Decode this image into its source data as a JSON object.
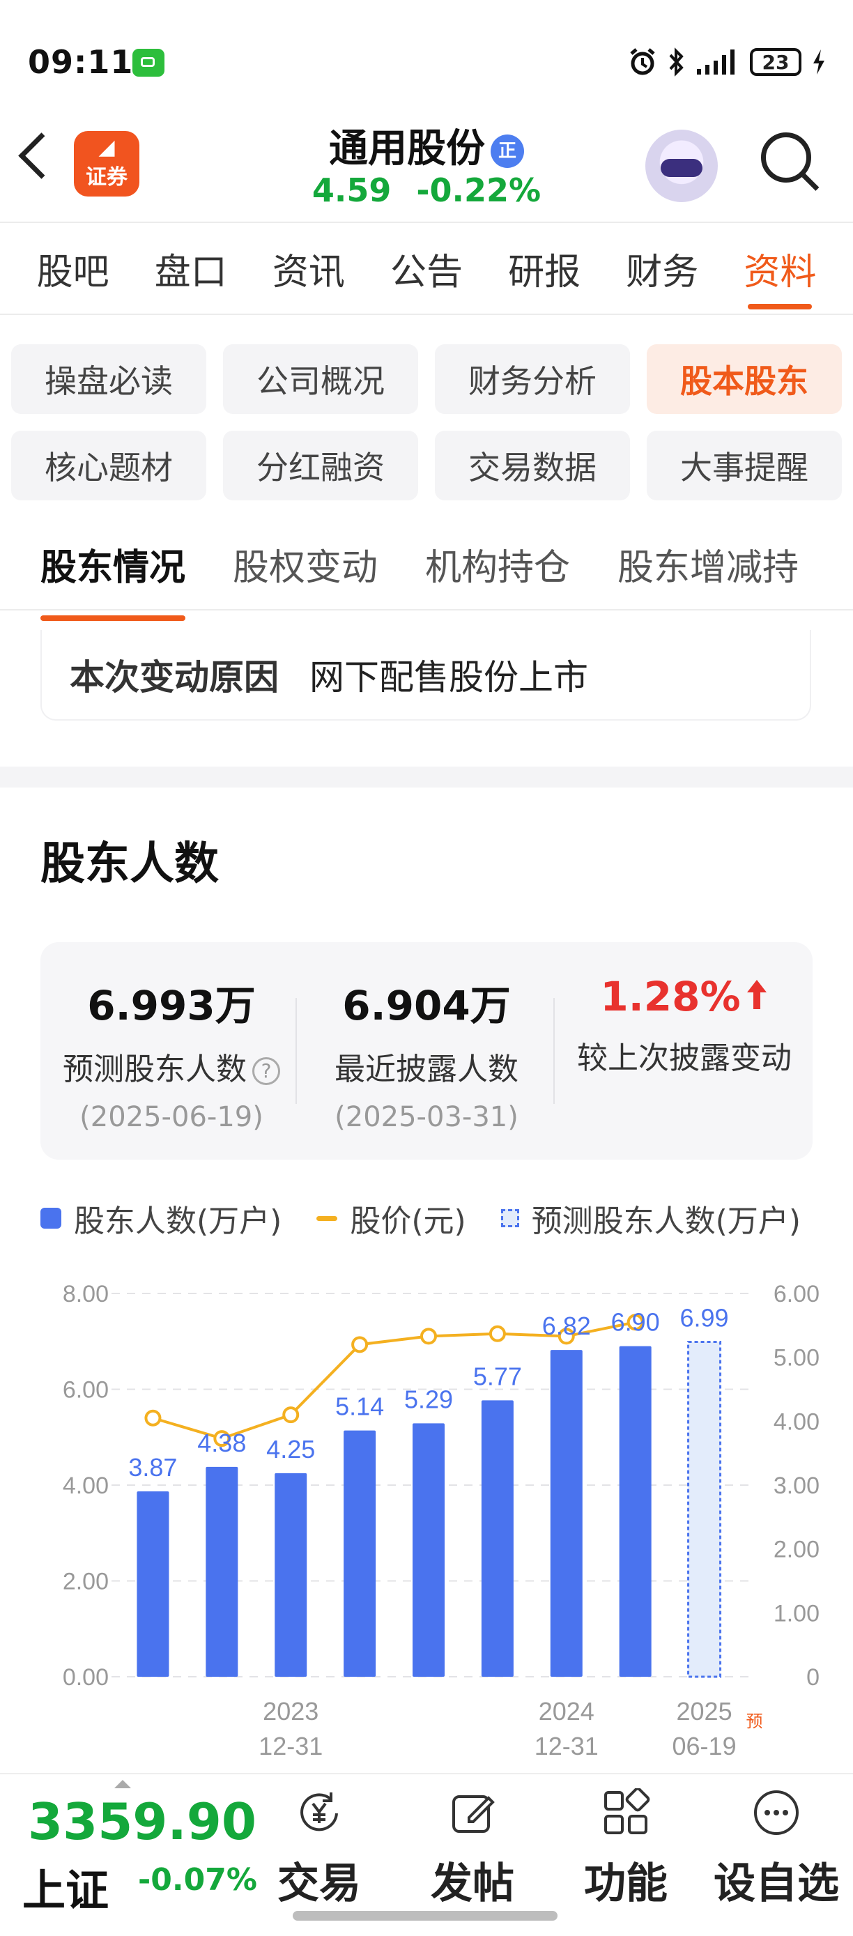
{
  "status_bar": {
    "time": "09:11",
    "battery": "23"
  },
  "header": {
    "app_logo_text": "证券",
    "stock_name": "通用股份",
    "badge": "正",
    "price": "4.59",
    "change_pct": "-0.22%"
  },
  "main_tabs": [
    "股吧",
    "盘口",
    "资讯",
    "公告",
    "研报",
    "财务",
    "资料"
  ],
  "chips": [
    "操盘必读",
    "公司概况",
    "财务分析",
    "股本股东",
    "核心题材",
    "分红融资",
    "交易数据",
    "大事提醒"
  ],
  "sub_tabs": [
    "股东情况",
    "股权变动",
    "机构持仓",
    "股东增减持"
  ],
  "reason": {
    "label": "本次变动原因",
    "value": "网下配售股份上市"
  },
  "section_title": "股东人数",
  "stats": [
    {
      "value": "6.993万",
      "label": "预测股东人数",
      "date": "(2025-06-19)"
    },
    {
      "value": "6.904万",
      "label": "最近披露人数",
      "date": "(2025-03-31)"
    },
    {
      "value": "1.28%",
      "label": "较上次披露变动"
    }
  ],
  "legend": {
    "bars": "股东人数(万户)",
    "line": "股价(元)",
    "forecast": "预测股东人数(万户)"
  },
  "chart_data": {
    "type": "bar",
    "categories": [
      "",
      "",
      "2023\n12-31",
      "",
      "",
      "",
      "2024\n12-31",
      "",
      "2025\n06-19"
    ],
    "x_tick_labels": [
      {
        "index": 2,
        "line1": "2023",
        "line2": "12-31"
      },
      {
        "index": 6,
        "line1": "2024",
        "line2": "12-31"
      },
      {
        "index": 8,
        "line1": "2025",
        "line2": "06-19"
      }
    ],
    "forecast_tag": "预",
    "series": [
      {
        "name": "股东人数(万户)",
        "type": "bar",
        "values": [
          3.87,
          4.38,
          4.25,
          5.14,
          5.29,
          5.77,
          6.82,
          6.9,
          null
        ],
        "labels": [
          "3.87",
          "4.38",
          "4.25",
          "5.14",
          "5.29",
          "5.77",
          "6.82",
          "6.90",
          ""
        ]
      },
      {
        "name": "预测股东人数(万户)",
        "type": "bar",
        "values": [
          null,
          null,
          null,
          null,
          null,
          null,
          null,
          null,
          6.99
        ],
        "labels": [
          "",
          "",
          "",
          "",
          "",
          "",
          "",
          "",
          "6.99"
        ]
      },
      {
        "name": "股价(元)",
        "type": "line",
        "axis": "right",
        "values": [
          4.05,
          3.73,
          4.1,
          5.2,
          5.33,
          5.37,
          5.33,
          5.55,
          null
        ]
      }
    ],
    "y_left": {
      "ticks": [
        "0.00",
        "2.00",
        "4.00",
        "6.00",
        "8.00"
      ],
      "min": 0,
      "max": 8
    },
    "y_right": {
      "ticks": [
        "0",
        "1.00",
        "2.00",
        "3.00",
        "4.00",
        "5.00",
        "6.00"
      ],
      "min": 0,
      "max": 6
    },
    "grid": true,
    "colors": {
      "bar": "#4a73ee",
      "line": "#f4b020",
      "forecast_fill": "#e3ecfb",
      "label": "#4a73ee"
    }
  },
  "bottom_bar": {
    "index_value": "3359.90",
    "index_name": "上证",
    "index_change": "-0.07%",
    "buttons": [
      {
        "label": "交易",
        "icon": "yen-cycle-icon"
      },
      {
        "label": "发帖",
        "icon": "edit-icon"
      },
      {
        "label": "功能",
        "icon": "grid-icon"
      },
      {
        "label": "设自选",
        "icon": "more-icon"
      }
    ]
  }
}
